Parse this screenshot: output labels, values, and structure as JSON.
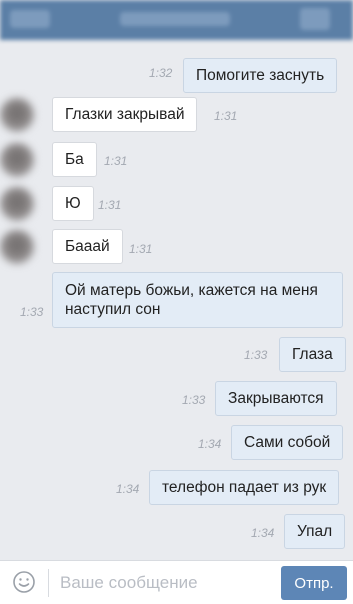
{
  "input": {
    "placeholder": "Ваше сообщение",
    "value": ""
  },
  "send_label": "Отпр.",
  "icons": {
    "emoji": "smiley-icon"
  },
  "colors": {
    "accent": "#5d86b6",
    "outgoing_bubble": "#e3ecf6",
    "incoming_bubble": "#ffffff"
  },
  "messages": [
    {
      "dir": "out",
      "text": "Помогите заснуть",
      "time": "1:32"
    },
    {
      "dir": "in",
      "text": "Глазки закрывай",
      "time": "1:31"
    },
    {
      "dir": "in",
      "text": "Ба",
      "time": "1:31"
    },
    {
      "dir": "in",
      "text": "Ю",
      "time": "1:31"
    },
    {
      "dir": "in",
      "text": "Бааай",
      "time": "1:31"
    },
    {
      "dir": "out",
      "text": "Ой матерь божьи, кажется на меня наступил сон",
      "time": "1:33"
    },
    {
      "dir": "out",
      "text": "Глаза",
      "time": "1:33"
    },
    {
      "dir": "out",
      "text": "Закрываются",
      "time": "1:33"
    },
    {
      "dir": "out",
      "text": "Сами собой",
      "time": "1:34"
    },
    {
      "dir": "out",
      "text": "телефон падает из рук",
      "time": "1:34"
    },
    {
      "dir": "out",
      "text": "Упал",
      "time": "1:34"
    }
  ]
}
